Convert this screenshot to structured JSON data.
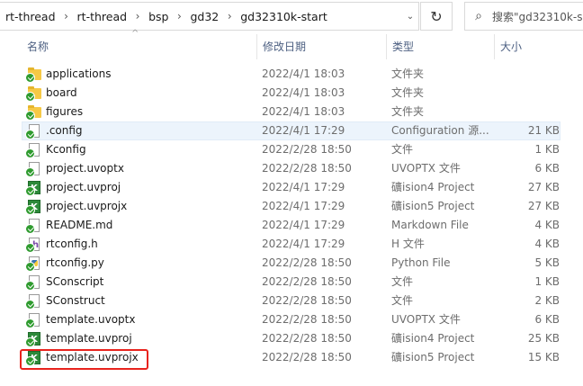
{
  "breadcrumb": [
    "rt-thread",
    "rt-thread",
    "bsp",
    "gd32",
    "gd32310k-start"
  ],
  "search": {
    "placeholder": "搜索\"gd32310k-s"
  },
  "columns": {
    "name": "名称",
    "date": "修改日期",
    "type": "类型",
    "size": "大小"
  },
  "files": [
    {
      "name": "applications",
      "date": "2022/4/1 18:03",
      "type": "文件夹",
      "size": "",
      "icon": "folder-icon"
    },
    {
      "name": "board",
      "date": "2022/4/1 18:03",
      "type": "文件夹",
      "size": "",
      "icon": "folder-icon"
    },
    {
      "name": "figures",
      "date": "2022/4/1 18:03",
      "type": "文件夹",
      "size": "",
      "icon": "folder-icon"
    },
    {
      "name": ".config",
      "date": "2022/4/1 17:29",
      "type": "Configuration 源...",
      "size": "21 KB",
      "icon": "file-icon"
    },
    {
      "name": "Kconfig",
      "date": "2022/2/28 18:50",
      "type": "文件",
      "size": "1 KB",
      "icon": "file-icon"
    },
    {
      "name": "project.uvoptx",
      "date": "2022/2/28 18:50",
      "type": "UVOPTX 文件",
      "size": "6 KB",
      "icon": "file-icon"
    },
    {
      "name": "project.uvproj",
      "date": "2022/4/1 17:29",
      "type": "礦ision4 Project",
      "size": "27 KB",
      "icon": "keil-project-icon"
    },
    {
      "name": "project.uvprojx",
      "date": "2022/4/1 17:29",
      "type": "礦ision5 Project",
      "size": "27 KB",
      "icon": "keil-project-icon"
    },
    {
      "name": "README.md",
      "date": "2022/4/1 17:29",
      "type": "Markdown File",
      "size": "4 KB",
      "icon": "file-icon"
    },
    {
      "name": "rtconfig.h",
      "date": "2022/4/1 17:29",
      "type": "H 文件",
      "size": "4 KB",
      "icon": "header-file-icon"
    },
    {
      "name": "rtconfig.py",
      "date": "2022/2/28 18:50",
      "type": "Python File",
      "size": "5 KB",
      "icon": "python-file-icon"
    },
    {
      "name": "SConscript",
      "date": "2022/2/28 18:50",
      "type": "文件",
      "size": "1 KB",
      "icon": "file-icon"
    },
    {
      "name": "SConstruct",
      "date": "2022/2/28 18:50",
      "type": "文件",
      "size": "2 KB",
      "icon": "file-icon"
    },
    {
      "name": "template.uvoptx",
      "date": "2022/2/28 18:50",
      "type": "UVOPTX 文件",
      "size": "6 KB",
      "icon": "file-icon"
    },
    {
      "name": "template.uvproj",
      "date": "2022/2/28 18:50",
      "type": "礦ision4 Project",
      "size": "25 KB",
      "icon": "keil-project-icon"
    },
    {
      "name": "template.uvprojx",
      "date": "2022/2/28 18:50",
      "type": "礦ision5 Project",
      "size": "15 KB",
      "icon": "keil-project-icon"
    }
  ],
  "selected_index": 3,
  "highlighted_index": 15,
  "colors": {
    "highlight": "#e8231d",
    "selection": "#ecf4fc",
    "header_text": "#4d6082"
  }
}
